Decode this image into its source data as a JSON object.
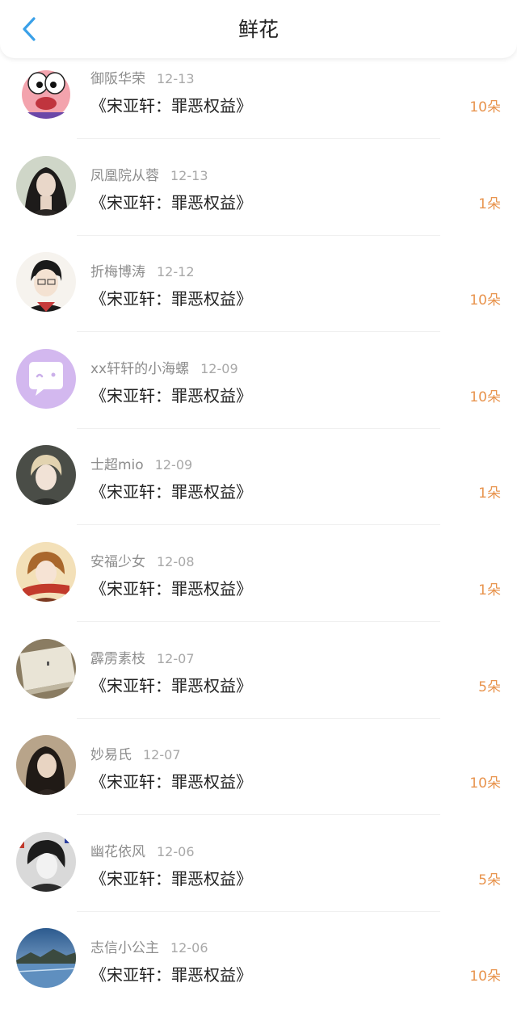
{
  "header": {
    "title": "鲜花",
    "back_icon": "chevron-left-icon"
  },
  "colors": {
    "accent_blue": "#3aa0e8",
    "count_orange": "#e8944e"
  },
  "items": [
    {
      "name": "御阪华荣",
      "date": "12-13",
      "book": "《宋亚轩：罪恶权益》",
      "count": "10朵",
      "avatar": "patrick-cartoon-avatar"
    },
    {
      "name": "凤凰院从蓉",
      "date": "12-13",
      "book": "《宋亚轩：罪恶权益》",
      "count": "1朵",
      "avatar": "long-hair-girl-avatar"
    },
    {
      "name": "折梅博涛",
      "date": "12-12",
      "book": "《宋亚轩：罪恶权益》",
      "count": "10朵",
      "avatar": "anime-boy-avatar"
    },
    {
      "name": "xx轩轩的小海螺",
      "date": "12-09",
      "book": "《宋亚轩：罪恶权益》",
      "count": "10朵",
      "avatar": "default-chat-avatar"
    },
    {
      "name": "士超mio",
      "date": "12-09",
      "book": "《宋亚轩：罪恶权益》",
      "count": "1朵",
      "avatar": "blond-boy-avatar"
    },
    {
      "name": "安福少女",
      "date": "12-08",
      "book": "《宋亚轩：罪恶权益》",
      "count": "1朵",
      "avatar": "red-scarf-avatar"
    },
    {
      "name": "霹雳素枝",
      "date": "12-07",
      "book": "《宋亚轩：罪恶权益》",
      "count": "5朵",
      "avatar": "notebook-avatar"
    },
    {
      "name": "妙易氏",
      "date": "12-07",
      "book": "《宋亚轩：罪恶权益》",
      "count": "10朵",
      "avatar": "dark-hair-girl-avatar"
    },
    {
      "name": "幽花依风",
      "date": "12-06",
      "book": "《宋亚轩：罪恶权益》",
      "count": "5朵",
      "avatar": "monochrome-art-avatar"
    },
    {
      "name": "志信小公主",
      "date": "12-06",
      "book": "《宋亚轩：罪恶权益》",
      "count": "10朵",
      "avatar": "lake-landscape-avatar"
    }
  ]
}
